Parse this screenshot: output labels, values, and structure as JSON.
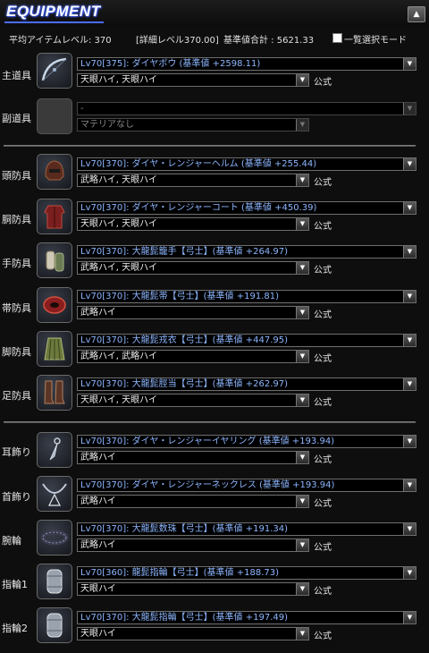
{
  "header": {
    "title": "EQUIPMENT",
    "collapse_symbol": "▲"
  },
  "summary": {
    "avg_item_level": "平均アイテムレベル: 370",
    "detail_level": "[詳細レベル370.00]",
    "base_total": "基準値合計 : 5621.33",
    "list_select_mode_label": "一覧選択モード",
    "list_select_mode_checked": false
  },
  "slots": [
    {
      "label": "主道具",
      "icon": "bow-icon",
      "item": "Lv70[375]: ダイヤボウ (基準値 +2598.11)",
      "materia": "天眼ハイ, 天眼ハイ",
      "official": "公式"
    },
    {
      "label": "副道具",
      "icon": "empty-slot-icon",
      "item": "-",
      "materia": "マテリアなし",
      "official": ""
    },
    {
      "label": "頭防具",
      "icon": "helm-icon",
      "item": "Lv70[370]: ダイヤ・レンジャーヘルム (基準値 +255.44)",
      "materia": "武略ハイ, 天眼ハイ",
      "official": "公式"
    },
    {
      "label": "胴防具",
      "icon": "coat-icon",
      "item": "Lv70[370]: ダイヤ・レンジャーコート (基準値 +450.39)",
      "materia": "天眼ハイ, 天眼ハイ",
      "official": "公式"
    },
    {
      "label": "手防具",
      "icon": "gloves-icon",
      "item": "Lv70[370]: 大龍髭籠手【弓士】(基準値 +264.97)",
      "materia": "武略ハイ, 天眼ハイ",
      "official": "公式"
    },
    {
      "label": "帯防具",
      "icon": "belt-icon",
      "item": "Lv70[370]: 大龍髭帯【弓士】(基準値 +191.81)",
      "materia": "武略ハイ",
      "official": "公式"
    },
    {
      "label": "脚防具",
      "icon": "skirt-icon",
      "item": "Lv70[370]: 大龍髭戎衣【弓士】(基準値 +447.95)",
      "materia": "武略ハイ, 武略ハイ",
      "official": "公式"
    },
    {
      "label": "足防具",
      "icon": "boots-icon",
      "item": "Lv70[370]: 大龍髭脛当【弓士】(基準値 +262.97)",
      "materia": "天眼ハイ, 天眼ハイ",
      "official": "公式"
    },
    {
      "label": "耳飾り",
      "icon": "earring-icon",
      "item": "Lv70[370]: ダイヤ・レンジャーイヤリング (基準値 +193.94)",
      "materia": "武略ハイ",
      "official": "公式"
    },
    {
      "label": "首飾り",
      "icon": "necklace-icon",
      "item": "Lv70[370]: ダイヤ・レンジャーネックレス (基準値 +193.94)",
      "materia": "武略ハイ",
      "official": "公式"
    },
    {
      "label": "腕輪",
      "icon": "bracelet-icon",
      "item": "Lv70[370]: 大龍髭数珠【弓士】(基準値 +191.34)",
      "materia": "武略ハイ",
      "official": "公式"
    },
    {
      "label": "指輪1",
      "icon": "ring-icon",
      "item": "Lv70[360]: 龍髭指輪【弓士】(基準値 +188.73)",
      "materia": "天眼ハイ",
      "official": "公式"
    },
    {
      "label": "指輪2",
      "icon": "ring-icon",
      "item": "Lv70[370]: 大龍髭指輪【弓士】(基準値 +197.49)",
      "materia": "天眼ハイ",
      "official": "公式"
    }
  ],
  "colors": {
    "accent": "#4a6cff",
    "item_text": "#8db6ff",
    "background": "#0e0e0e"
  }
}
